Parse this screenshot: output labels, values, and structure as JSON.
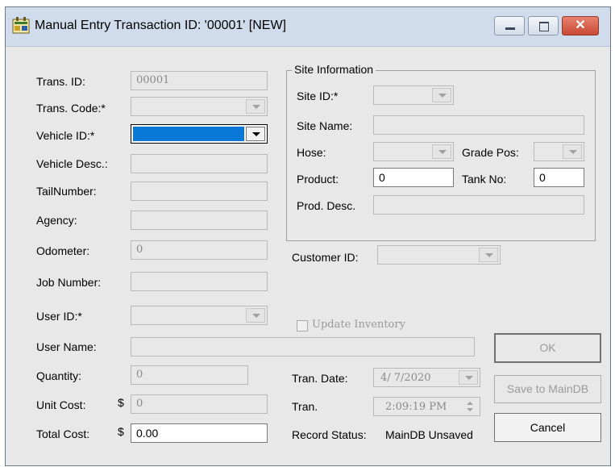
{
  "window": {
    "title": "Manual Entry Transaction ID: '00001' [NEW]",
    "controls": {
      "minimize_icon": "minimize-icon",
      "maximize_icon": "maximize-icon",
      "close_label": "✕"
    }
  },
  "form": {
    "trans_id": {
      "label": "Trans. ID:",
      "value": "00001"
    },
    "trans_code": {
      "label": "Trans. Code:*",
      "value": ""
    },
    "vehicle_id": {
      "label": "Vehicle ID:*",
      "value": ""
    },
    "vehicle_desc": {
      "label": "Vehicle Desc.:",
      "value": ""
    },
    "tail_number": {
      "label": "TailNumber:",
      "value": ""
    },
    "agency": {
      "label": "Agency:",
      "value": ""
    },
    "odometer": {
      "label": "Odometer:",
      "value": "0"
    },
    "job_number": {
      "label": "Job Number:",
      "value": ""
    },
    "user_id": {
      "label": "User ID:*",
      "value": ""
    },
    "user_name": {
      "label": "User Name:",
      "value": ""
    },
    "quantity": {
      "label": "Quantity:",
      "value": "0"
    },
    "unit_cost": {
      "label": "Unit Cost:",
      "currency": "$",
      "value": "0"
    },
    "total_cost": {
      "label": "Total Cost:",
      "currency": "$",
      "value": "0.00"
    },
    "customer_id": {
      "label": "Customer ID:",
      "value": ""
    },
    "update_inventory": {
      "label": "Update Inventory",
      "checked": false
    },
    "tran_date": {
      "label": "Tran. Date:",
      "value": "4/ 7/2020"
    },
    "tran_time": {
      "label": "Tran.",
      "value": "2:09:19 PM"
    },
    "record_status": {
      "label": "Record Status:",
      "value": "MainDB Unsaved"
    }
  },
  "site": {
    "group_title": "Site Information",
    "site_id": {
      "label": "Site ID:*",
      "value": ""
    },
    "site_name": {
      "label": "Site Name:",
      "value": ""
    },
    "hose": {
      "label": "Hose:",
      "value": ""
    },
    "grade_pos": {
      "label": "Grade Pos:",
      "value": ""
    },
    "product": {
      "label": "Product:",
      "value": "0"
    },
    "tank_no": {
      "label": "Tank No:",
      "value": "0"
    },
    "prod_desc": {
      "label": "Prod. Desc.",
      "value": ""
    }
  },
  "buttons": {
    "ok": "OK",
    "save": "Save to MainDB",
    "cancel": "Cancel"
  },
  "colors": {
    "selection": "#0a78d7",
    "titlebar": "#d0dcec",
    "close_button": "#c84a33",
    "window_bg": "#e8e8e8"
  }
}
